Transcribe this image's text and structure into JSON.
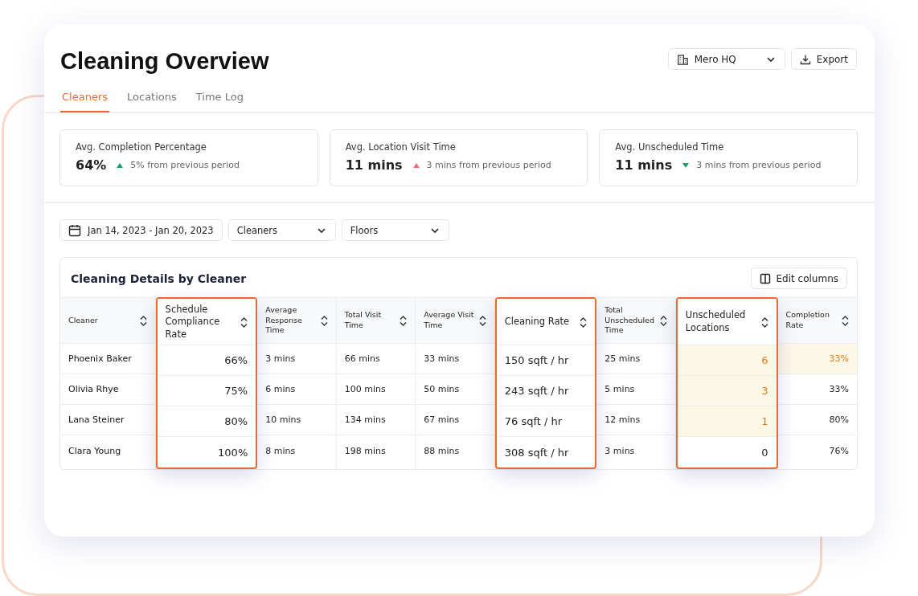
{
  "header": {
    "title": "Cleaning Overview",
    "site_select": {
      "value": "Mero HQ"
    },
    "export_button": "Export"
  },
  "tabs": [
    {
      "label": "Cleaners",
      "selected": true
    },
    {
      "label": "Locations",
      "selected": false
    },
    {
      "label": "Time Log",
      "selected": false
    }
  ],
  "stats": [
    {
      "label": "Avg. Completion Percentage",
      "value": "64%",
      "delta": "5% from previous period",
      "rising": true,
      "favorable": true
    },
    {
      "label": "Avg. Location Visit Time",
      "value": "11 mins",
      "delta": "3 mins from previous period",
      "rising": true,
      "favorable": false
    },
    {
      "label": "Avg. Unscheduled Time",
      "value": "11 mins",
      "delta": "3 mins from previous period",
      "rising": false,
      "favorable": true
    }
  ],
  "filters": {
    "date_range": "Jan 14, 2023 - Jan 20, 2023",
    "dropdowns": [
      "Cleaners",
      "Floors"
    ]
  },
  "table": {
    "title": "Cleaning Details by Cleaner",
    "edit_button": "Edit columns",
    "columns": [
      {
        "label": "Cleaner",
        "highlighted": false,
        "numeric": false
      },
      {
        "label": "Schedule Compliance Rate",
        "highlighted": true,
        "numeric": true
      },
      {
        "label": "Average Response Time",
        "highlighted": false,
        "numeric": false
      },
      {
        "label": "Total Visit Time",
        "highlighted": false,
        "numeric": false
      },
      {
        "label": "Average Visit Time",
        "highlighted": false,
        "numeric": false
      },
      {
        "label": "Cleaning Rate",
        "highlighted": true,
        "numeric": false
      },
      {
        "label": "Total Unscheduled Time",
        "highlighted": false,
        "numeric": false
      },
      {
        "label": "Unscheduled Locations",
        "highlighted": true,
        "numeric": true
      },
      {
        "label": "Completion Rate",
        "highlighted": false,
        "numeric": true
      }
    ],
    "rows": [
      {
        "cells": [
          {
            "text": "Phoenix Baker",
            "flagged": false
          },
          {
            "text": "66%",
            "flagged": false
          },
          {
            "text": "3 mins",
            "flagged": false
          },
          {
            "text": "66 mins",
            "flagged": false
          },
          {
            "text": "33 mins",
            "flagged": false
          },
          {
            "text": "150 sqft / hr",
            "flagged": false
          },
          {
            "text": "25 mins",
            "flagged": false
          },
          {
            "text": "6",
            "flagged": true
          },
          {
            "text": "33%",
            "flagged": true
          }
        ]
      },
      {
        "cells": [
          {
            "text": "Olivia Rhye",
            "flagged": false
          },
          {
            "text": "75%",
            "flagged": false
          },
          {
            "text": "6 mins",
            "flagged": false
          },
          {
            "text": "100 mins",
            "flagged": false
          },
          {
            "text": "50 mins",
            "flagged": false
          },
          {
            "text": "243 sqft / hr",
            "flagged": false
          },
          {
            "text": "5 mins",
            "flagged": false
          },
          {
            "text": "3",
            "flagged": true
          },
          {
            "text": "33%",
            "flagged": false
          }
        ]
      },
      {
        "cells": [
          {
            "text": "Lana Steiner",
            "flagged": false
          },
          {
            "text": "80%",
            "flagged": false
          },
          {
            "text": "10 mins",
            "flagged": false
          },
          {
            "text": "134 mins",
            "flagged": false
          },
          {
            "text": "67 mins",
            "flagged": false
          },
          {
            "text": "76 sqft / hr",
            "flagged": false
          },
          {
            "text": "12 mins",
            "flagged": false
          },
          {
            "text": "1",
            "flagged": true
          },
          {
            "text": "80%",
            "flagged": false
          }
        ]
      },
      {
        "cells": [
          {
            "text": "Clara Young",
            "flagged": false
          },
          {
            "text": "100%",
            "flagged": false
          },
          {
            "text": "8 mins",
            "flagged": false
          },
          {
            "text": "198 mins",
            "flagged": false
          },
          {
            "text": "88 mins",
            "flagged": false
          },
          {
            "text": "308 sqft / hr",
            "flagged": false
          },
          {
            "text": "3 mins",
            "flagged": false
          },
          {
            "text": "0",
            "flagged": false
          },
          {
            "text": "76%",
            "flagged": false
          }
        ]
      }
    ]
  }
}
